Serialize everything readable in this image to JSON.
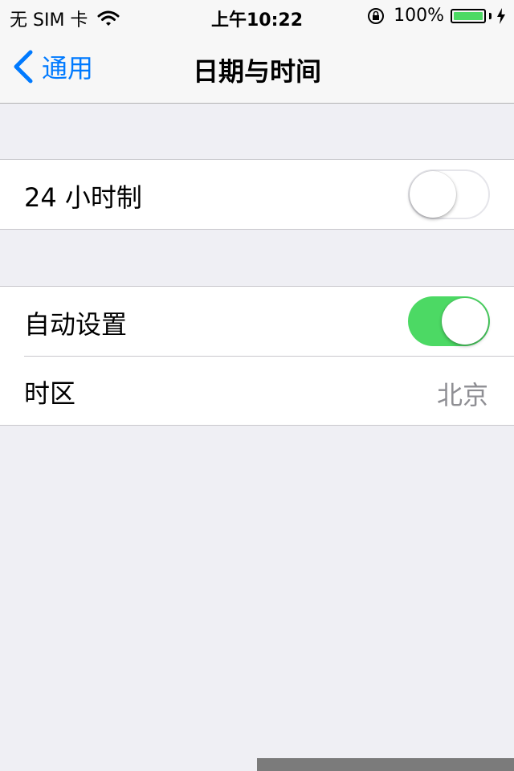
{
  "status_bar": {
    "carrier": "无 SIM 卡",
    "time": "上午10:22",
    "battery_percent": "100%",
    "battery_level": 1.0,
    "icons": [
      "wifi-icon",
      "rotation-lock-icon",
      "battery-icon",
      "charging-bolt-icon"
    ]
  },
  "nav": {
    "back_label": "通用",
    "title": "日期与时间"
  },
  "settings": {
    "clock_24h": {
      "label": "24 小时制",
      "enabled": false
    },
    "auto_set": {
      "label": "自动设置",
      "enabled": true
    },
    "timezone": {
      "label": "时区",
      "value": "北京"
    }
  },
  "colors": {
    "accent": "#007aff",
    "toggle_on": "#4cd964",
    "background": "#efeff4",
    "secondary_text": "#8e8e93"
  }
}
